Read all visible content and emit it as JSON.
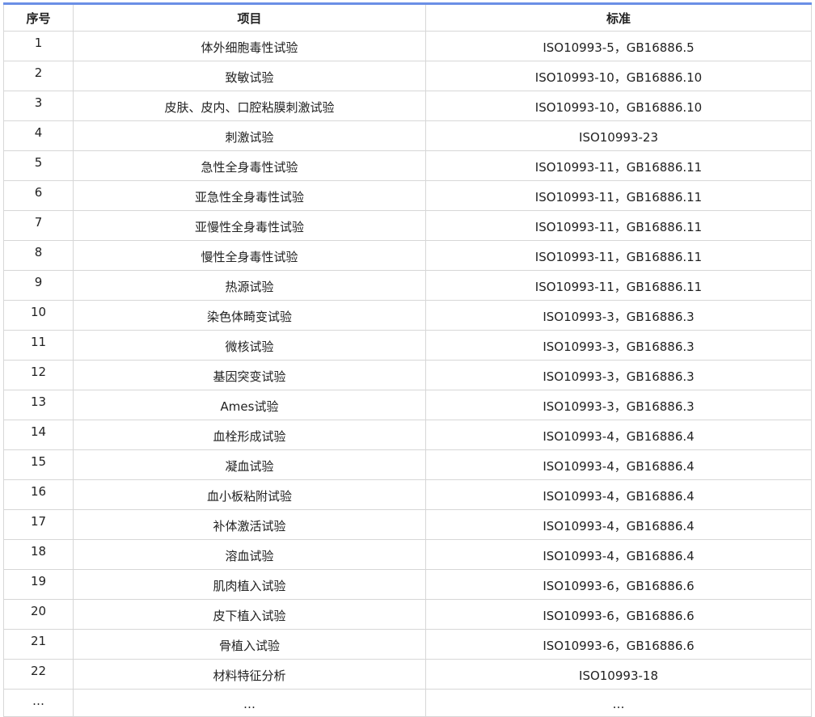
{
  "headers": [
    "序号",
    "项目",
    "标准"
  ],
  "rows": [
    [
      "1",
      "体外细胞毒性试验",
      "ISO10993-5，GB16886.5"
    ],
    [
      "2",
      "致敏试验",
      "ISO10993-10，GB16886.10"
    ],
    [
      "3",
      "皮肤、皮内、口腔粘膜刺激试验",
      "ISO10993-10，GB16886.10"
    ],
    [
      "4",
      "刺激试验",
      "ISO10993-23"
    ],
    [
      "5",
      "急性全身毒性试验",
      "ISO10993-11，GB16886.11"
    ],
    [
      "6",
      "亚急性全身毒性试验",
      "ISO10993-11，GB16886.11"
    ],
    [
      "7",
      "亚慢性全身毒性试验",
      "ISO10993-11，GB16886.11"
    ],
    [
      "8",
      "慢性全身毒性试验",
      "ISO10993-11，GB16886.11"
    ],
    [
      "9",
      "热源试验",
      "ISO10993-11，GB16886.11"
    ],
    [
      "10",
      "染色体畸变试验",
      "ISO10993-3，GB16886.3"
    ],
    [
      "11",
      "微核试验",
      "ISO10993-3，GB16886.3"
    ],
    [
      "12",
      "基因突变试验",
      "ISO10993-3，GB16886.3"
    ],
    [
      "13",
      "Ames试验",
      "ISO10993-3，GB16886.3"
    ],
    [
      "14",
      "血栓形成试验",
      "ISO10993-4，GB16886.4"
    ],
    [
      "15",
      "凝血试验",
      "ISO10993-4，GB16886.4"
    ],
    [
      "16",
      "血小板粘附试验",
      "ISO10993-4，GB16886.4"
    ],
    [
      "17",
      "补体激活试验",
      "ISO10993-4，GB16886.4"
    ],
    [
      "18",
      "溶血试验",
      "ISO10993-4，GB16886.4"
    ],
    [
      "19",
      "肌肉植入试验",
      "ISO10993-6，GB16886.6"
    ],
    [
      "20",
      "皮下植入试验",
      "ISO10993-6，GB16886.6"
    ],
    [
      "21",
      "骨植入试验",
      "ISO10993-6，GB16886.6"
    ],
    [
      "22",
      "材料特征分析",
      "ISO10993-18"
    ],
    [
      "…",
      "…",
      "…"
    ]
  ],
  "colors": {
    "header_rule": "#6b8fe6",
    "grid": "#d7d7d7"
  }
}
